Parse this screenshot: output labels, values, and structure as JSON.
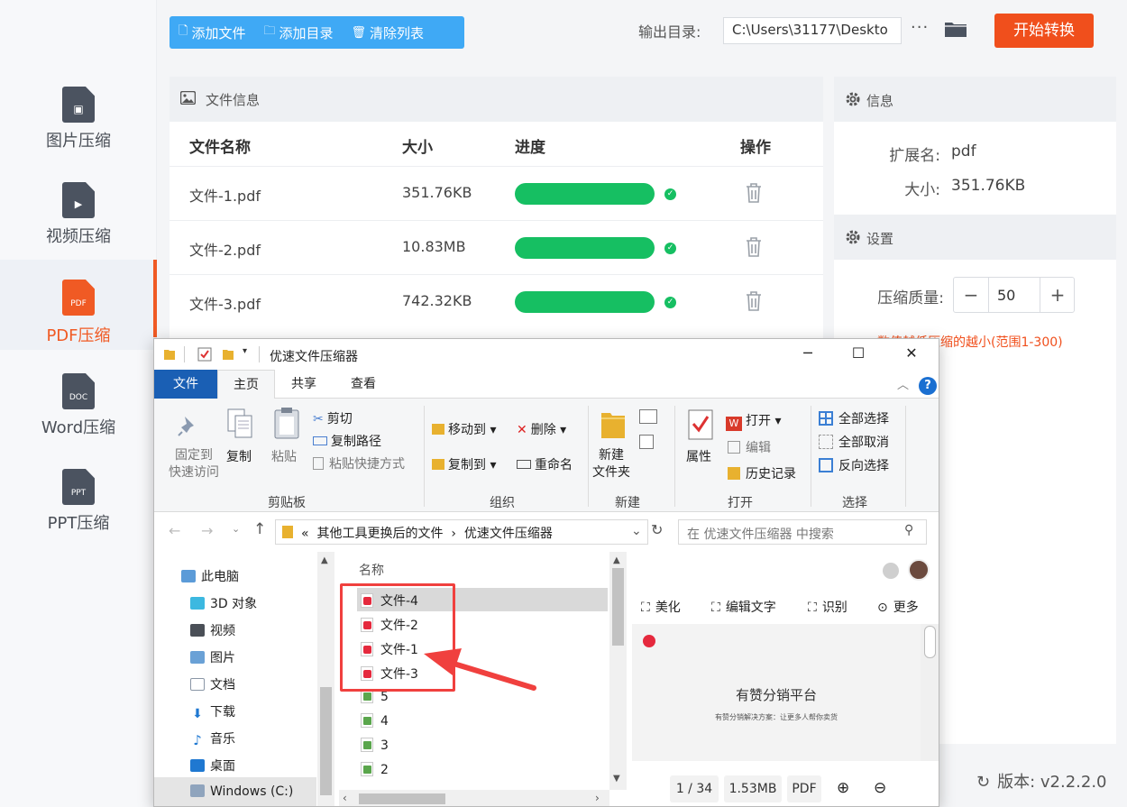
{
  "sidebar": {
    "items": [
      {
        "label": "图片压缩",
        "icon": "image-file-icon",
        "badge": ""
      },
      {
        "label": "视频压缩",
        "icon": "video-file-icon",
        "badge": ""
      },
      {
        "label": "PDF压缩",
        "icon": "pdf-file-icon",
        "badge": "PDF",
        "active": true
      },
      {
        "label": "Word压缩",
        "icon": "doc-file-icon",
        "badge": "DOC"
      },
      {
        "label": "PPT压缩",
        "icon": "ppt-file-icon",
        "badge": "PPT"
      }
    ]
  },
  "toolbar": {
    "add_file": "添加文件",
    "add_dir": "添加目录",
    "clear_list": "清除列表",
    "output_label": "输出目录:",
    "output_path": "C:\\Users\\31177\\Deskto",
    "more": "···",
    "start": "开始转换"
  },
  "file_panel": {
    "title": "文件信息",
    "columns": [
      "文件名称",
      "大小",
      "进度",
      "操作"
    ],
    "rows": [
      {
        "name": "文件-1.pdf",
        "size": "351.76KB",
        "progress": 1.0
      },
      {
        "name": "文件-2.pdf",
        "size": "10.83MB",
        "progress": 1.0
      },
      {
        "name": "文件-3.pdf",
        "size": "742.32KB",
        "progress": 1.0
      }
    ]
  },
  "info_panel": {
    "title": "信息",
    "ext_label": "扩展名:",
    "ext_value": "pdf",
    "size_label": "大小:",
    "size_value": "351.76KB"
  },
  "settings": {
    "title": "设置",
    "quality_label": "压缩质量:",
    "quality_value": "50",
    "minus": "−",
    "plus": "+",
    "hint": "数值越低压缩的越小(范围1-300)"
  },
  "version": "版本: v2.2.2.0",
  "explorer": {
    "title": "优速文件压缩器",
    "tabs": [
      "文件",
      "主页",
      "共享",
      "查看"
    ],
    "ribbon": {
      "pin": "固定到\n快速访问",
      "copy": "复制",
      "paste": "粘贴",
      "cut": "剪切",
      "copy_path": "复制路径",
      "paste_shortcut": "粘贴快捷方式",
      "move_to": "移动到",
      "delete": "删除",
      "copy_to": "复制到",
      "rename": "重命名",
      "new_folder": "新建\n文件夹",
      "properties": "属性",
      "open": "打开",
      "edit": "编辑",
      "history": "历史记录",
      "select_all": "全部选择",
      "select_none": "全部取消",
      "invert": "反向选择",
      "groups": [
        "剪贴板",
        "组织",
        "新建",
        "打开",
        "选择"
      ]
    },
    "address": {
      "prefix": "«",
      "part1": "其他工具更换后的文件",
      "sep": "›",
      "part2": "优速文件压缩器",
      "search_placeholder": "在 优速文件压缩器 中搜索"
    },
    "nav": [
      "此电脑",
      "3D 对象",
      "视频",
      "图片",
      "文档",
      "下载",
      "音乐",
      "桌面",
      "Windows (C:)"
    ],
    "list_header": "名称",
    "files": [
      {
        "name": "文件-4",
        "type": "pdf"
      },
      {
        "name": "文件-2",
        "type": "pdf"
      },
      {
        "name": "文件-1",
        "type": "pdf"
      },
      {
        "name": "文件-3",
        "type": "pdf"
      },
      {
        "name": "5",
        "type": "xls"
      },
      {
        "name": "4",
        "type": "xls"
      },
      {
        "name": "3",
        "type": "xls"
      },
      {
        "name": "2",
        "type": "xls"
      }
    ],
    "preview": {
      "beautify": "美化",
      "edit_text": "编辑文字",
      "recognize": "识别",
      "more": "更多",
      "doc_title": "有赞分销平台",
      "doc_sub": "有赞分销解决方案：让更多人帮你卖货",
      "page": "1 / 34",
      "size": "1.53MB",
      "type": "PDF"
    }
  }
}
